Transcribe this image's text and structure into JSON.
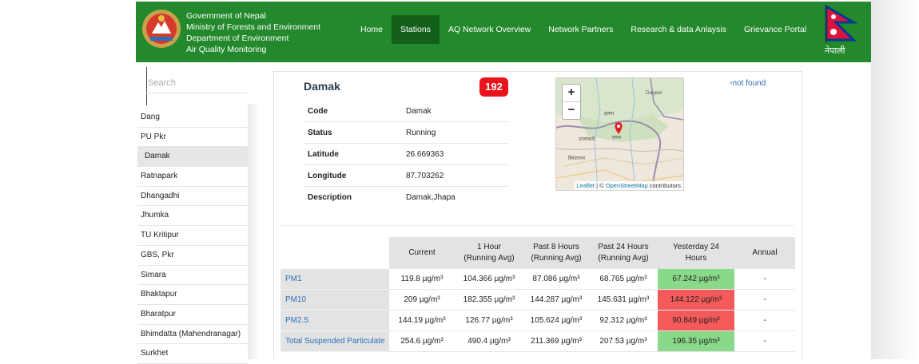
{
  "header": {
    "gov_lines": [
      "Government of Nepal",
      "Ministry of Forests and Environment",
      "Department of Environment",
      "Air Quality Monitoring"
    ],
    "nav": [
      {
        "label": "Home",
        "active": false
      },
      {
        "label": "Stations",
        "active": true
      },
      {
        "label": "AQ Network Overview",
        "active": false
      },
      {
        "label": "Network Partners",
        "active": false
      },
      {
        "label": "Research & data Anlaysis",
        "active": false
      },
      {
        "label": "Grievance Portal",
        "active": false
      }
    ],
    "language": "नेपाली",
    "colors": {
      "bar": "#23892c",
      "active_tab": "#14601b"
    }
  },
  "search": {
    "placeholder": "Search"
  },
  "sidebar": {
    "items": [
      "Dang",
      "PU Pkr",
      "Damak",
      "Ratnapark",
      "Dhangadhi",
      "Jhumka",
      "TU Kritipur",
      "GBS, Pkr",
      "Simara",
      "Bhaktapur",
      "Bharatpur",
      "Bhimdatta (Mahendranagar)",
      "Surkhet"
    ],
    "active_index": 2
  },
  "station": {
    "name": "Damak",
    "aqi": "192",
    "aqi_color": "#e8131b",
    "info": [
      {
        "label": "Code",
        "value": "Damak"
      },
      {
        "label": "Status",
        "value": "Running"
      },
      {
        "label": "Latitude",
        "value": "26.669363"
      },
      {
        "label": "Longitude",
        "value": "87.703262"
      },
      {
        "label": "Description",
        "value": "Damak,Jhapa"
      }
    ]
  },
  "map": {
    "zoom_in": "+",
    "zoom_out": "−",
    "labels": {
      "darjeeling": "Darjeel",
      "ilam": "इलाम",
      "city": "दमक",
      "urlabari": "उरलाबारी",
      "biratnagar": "बिराटनगर"
    },
    "attribution": {
      "leaflet": "Leaflet",
      "sep": " | © ",
      "osm": "OpenStreetMap",
      "tail": " contributors"
    }
  },
  "image_alt": "not found",
  "pollutants": {
    "headers": [
      "",
      "Current",
      "1 Hour\n(Running Avg)",
      "Past 8 Hours\n(Running Avg)",
      "Past 24 Hours\n(Running Avg)",
      "Yesterday 24\nHours",
      "Annual"
    ],
    "rows": [
      {
        "name": "PM1",
        "values": [
          "119.8 µg/m³",
          "104.366 µg/m³",
          "87.086 µg/m³",
          "68.765 µg/m³",
          "67.242 µg/m³",
          "-"
        ],
        "yesterday_status": "good"
      },
      {
        "name": "PM10",
        "values": [
          "209 µg/m³",
          "182.355 µg/m³",
          "144.287 µg/m³",
          "145.631 µg/m³",
          "144.122 µg/m³",
          "-"
        ],
        "yesterday_status": "bad"
      },
      {
        "name": "PM2.5",
        "values": [
          "144.19 µg/m³",
          "126.77 µg/m³",
          "105.624 µg/m³",
          "92.312 µg/m³",
          "90.849 µg/m³",
          "-"
        ],
        "yesterday_status": "bad"
      },
      {
        "name": "Total Suspended Particulate",
        "values": [
          "254.6 µg/m³",
          "490.4 µg/m³",
          "211.369 µg/m³",
          "207.53 µg/m³",
          "196.35 µg/m³",
          "-"
        ],
        "yesterday_status": "good"
      }
    ],
    "colors": {
      "good": "#8ad98a",
      "bad": "#f45a5a"
    }
  }
}
